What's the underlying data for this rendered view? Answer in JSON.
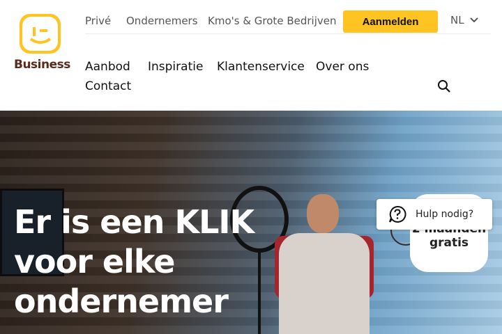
{
  "brand": {
    "logo_text": "Business",
    "accent": "#ffc421",
    "logo_text_color": "#5b2a1a"
  },
  "topnav": {
    "links": [
      "Privé",
      "Ondernemers",
      "Kmo's & Grote Bedrijven"
    ],
    "cta_label": "Aanmelden",
    "language": "NL"
  },
  "mainnav": {
    "items": [
      "Aanbod",
      "Inspiratie",
      "Klantenservice",
      "Over ons",
      "Contact"
    ]
  },
  "icons": {
    "search": "search-icon",
    "help": "help-question-icon",
    "chevron": "chevron-down-icon"
  },
  "hero": {
    "headline_lines": [
      "Er is een KLIK",
      "voor elke",
      "ondernemer"
    ],
    "badge_line1": "2 maanden",
    "badge_line2": "gratis"
  },
  "help_widget": {
    "label": "Hulp nodig?"
  }
}
